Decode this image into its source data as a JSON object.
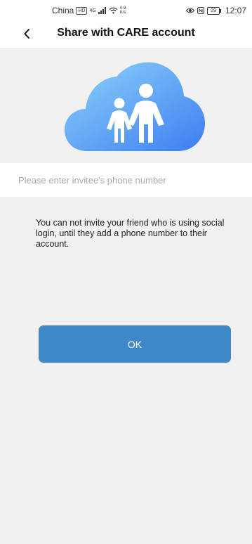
{
  "status_bar": {
    "carrier": "China",
    "badge": "HD",
    "network": "4G",
    "speed_value": "0.9",
    "speed_unit": "K/s",
    "battery": "29",
    "time": "12:07"
  },
  "header": {
    "title": "Share with CARE account"
  },
  "phone_input": {
    "placeholder": "Please enter invitee's phone number",
    "value": ""
  },
  "dialog": {
    "message": "You can not invite your friend who is using social login, until they add a phone number to their account.",
    "ok_label": "OK"
  },
  "colors": {
    "accent": "#3f88c8",
    "panel_bg": "#f1f1f1",
    "cloud_light": "#8fd3fb",
    "cloud_dark": "#3c7ef0"
  },
  "icons": {
    "back": "chevron-left-icon",
    "hero": "cloud-family-icon"
  }
}
